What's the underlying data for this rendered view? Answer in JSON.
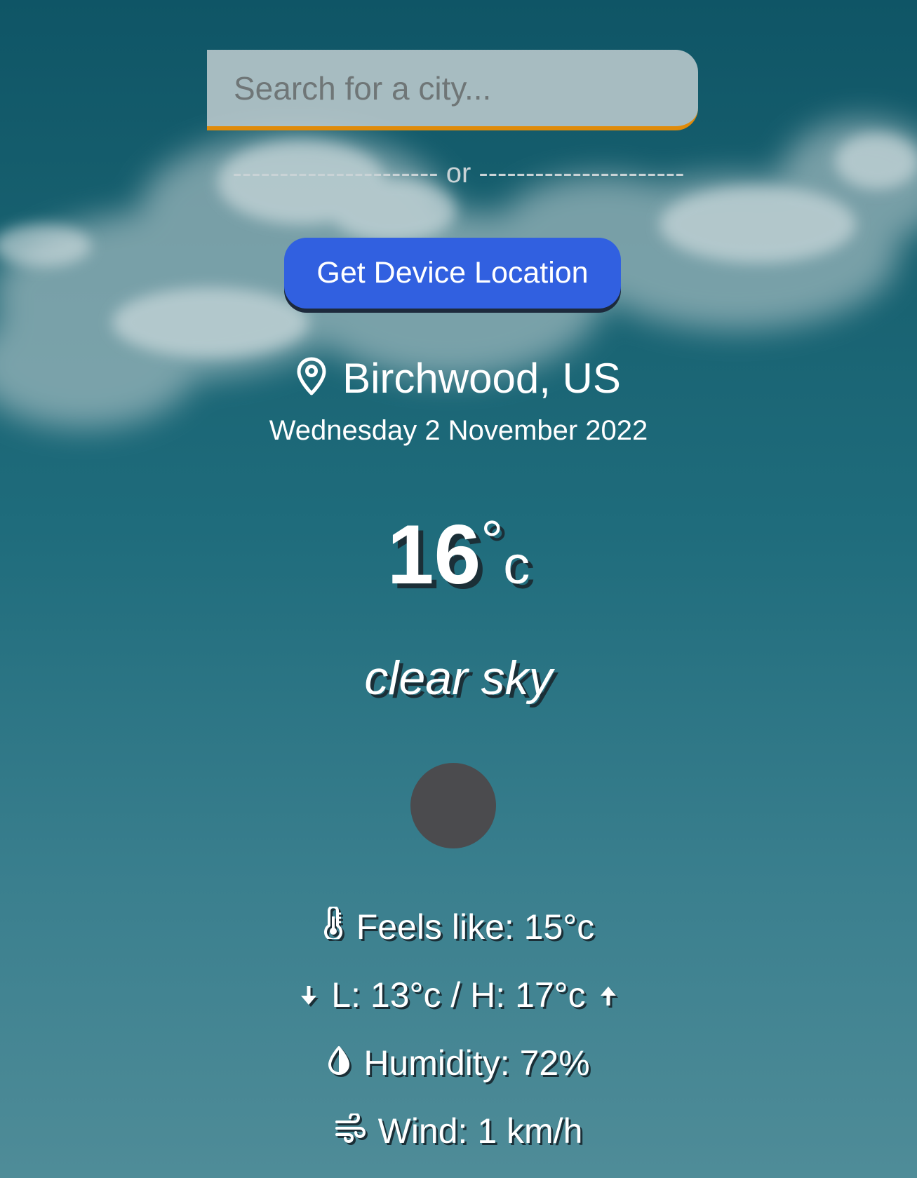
{
  "search": {
    "placeholder": "Search for a city..."
  },
  "divider": {
    "text": "---------------------- or ----------------------"
  },
  "location_button": {
    "label": "Get Device Location"
  },
  "location": {
    "icon": "map-pin-icon",
    "city": "Birchwood, US",
    "date": "Wednesday 2 November 2022"
  },
  "current": {
    "temperature": "16",
    "degree_symbol": "°",
    "unit": "c",
    "description": "clear sky",
    "weather_icon": "weather-condition-icon"
  },
  "details": {
    "feels_like": "Feels like: 15°c",
    "low_high": "L: 13°c / H: 17°c",
    "humidity": "Humidity: 72%",
    "wind": "Wind: 1 km/h"
  },
  "colors": {
    "accent_orange": "#e08b0a",
    "button_blue": "#3160e0",
    "text": "#ffffff",
    "text_shadow": "#1b2f37"
  }
}
